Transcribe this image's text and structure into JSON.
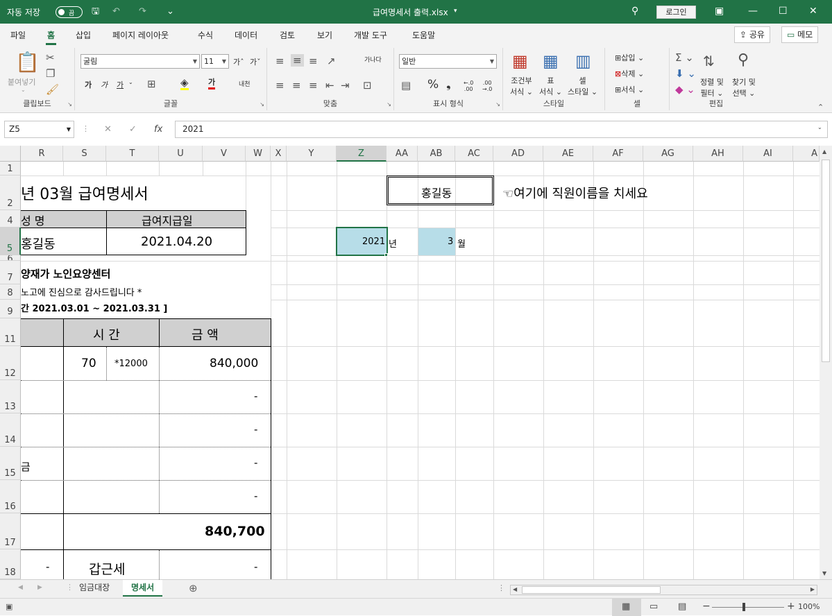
{
  "titlebar": {
    "autosave_label": "자동 저장",
    "autosave_state": "끔",
    "filename": "급여명세서 출력.xlsx",
    "login": "로그인",
    "save_icon": "save-icon",
    "undo_icon": "undo-icon",
    "redo_icon": "redo-icon"
  },
  "menu": {
    "tabs": [
      "파일",
      "홈",
      "삽입",
      "페이지 레이아웃",
      "수식",
      "데이터",
      "검토",
      "보기",
      "개발 도구",
      "도움말"
    ],
    "active": "홈",
    "share": "공유",
    "memo": "메모"
  },
  "ribbon": {
    "clipboard": {
      "label": "클립보드",
      "paste": "붙여넣기"
    },
    "font": {
      "label": "글꼴",
      "name": "굴림",
      "size": "11",
      "bold": "가",
      "italic": "가",
      "underline": "가",
      "color_char": "가"
    },
    "align": {
      "label": "맞춤",
      "wrap": "가나다"
    },
    "number": {
      "label": "표시 형식",
      "format": "일반"
    },
    "styles": {
      "label": "스타일",
      "cond1": "조건부",
      "cond2": "서식",
      "table1": "표",
      "table2": "서식",
      "cell1": "셀",
      "cell2": "스타일"
    },
    "cells": {
      "label": "셀",
      "insert": "삽입",
      "delete": "삭제",
      "format": "서식"
    },
    "editing": {
      "label": "편집",
      "sort1": "정렬 및",
      "sort2": "필터",
      "find1": "찾기 및",
      "find2": "선택"
    }
  },
  "formula_bar": {
    "namebox": "Z5",
    "value": "2021"
  },
  "columns": [
    "R",
    "S",
    "T",
    "U",
    "V",
    "W",
    "X",
    "Y",
    "Z",
    "AA",
    "AB",
    "AC",
    "AD",
    "AE",
    "AF",
    "AG",
    "AH",
    "AI",
    "A"
  ],
  "rows": [
    "1",
    "2",
    "4",
    "5",
    "6",
    "7",
    "8",
    "9",
    "11",
    "12",
    "13",
    "14",
    "15",
    "16",
    "17",
    "18"
  ],
  "sheet": {
    "title": "년 03월 급여명세서",
    "name_header": "성    명",
    "paydate_header": "급여지급일",
    "name_value": "홍길동",
    "paydate_value": "2021.04.20",
    "company": "양재가 노인요양센터",
    "thanks": "노고에 진심으로 감사드립니다 *",
    "period": "간 2021.03.01 ~ 2021.03.31 ]",
    "hours_header": "시  간",
    "amount_header": "금    액",
    "r12_hours": "70",
    "r12_rate": "*12000",
    "r12_amount": "840,000",
    "dash": "-",
    "r15_label": "금",
    "total": "840,700",
    "r18_dash": "-",
    "r18_label": "갑근세",
    "employee": "홍길동",
    "instruction": "☜여기에 직원이름을 치세요",
    "year_value": "2021",
    "year_unit": "년",
    "month_value": "3",
    "month_unit": "월"
  },
  "sheets": {
    "tabs": [
      "임금대장",
      "명세서"
    ],
    "active": "명세서"
  },
  "status": {
    "zoom": "100%"
  }
}
